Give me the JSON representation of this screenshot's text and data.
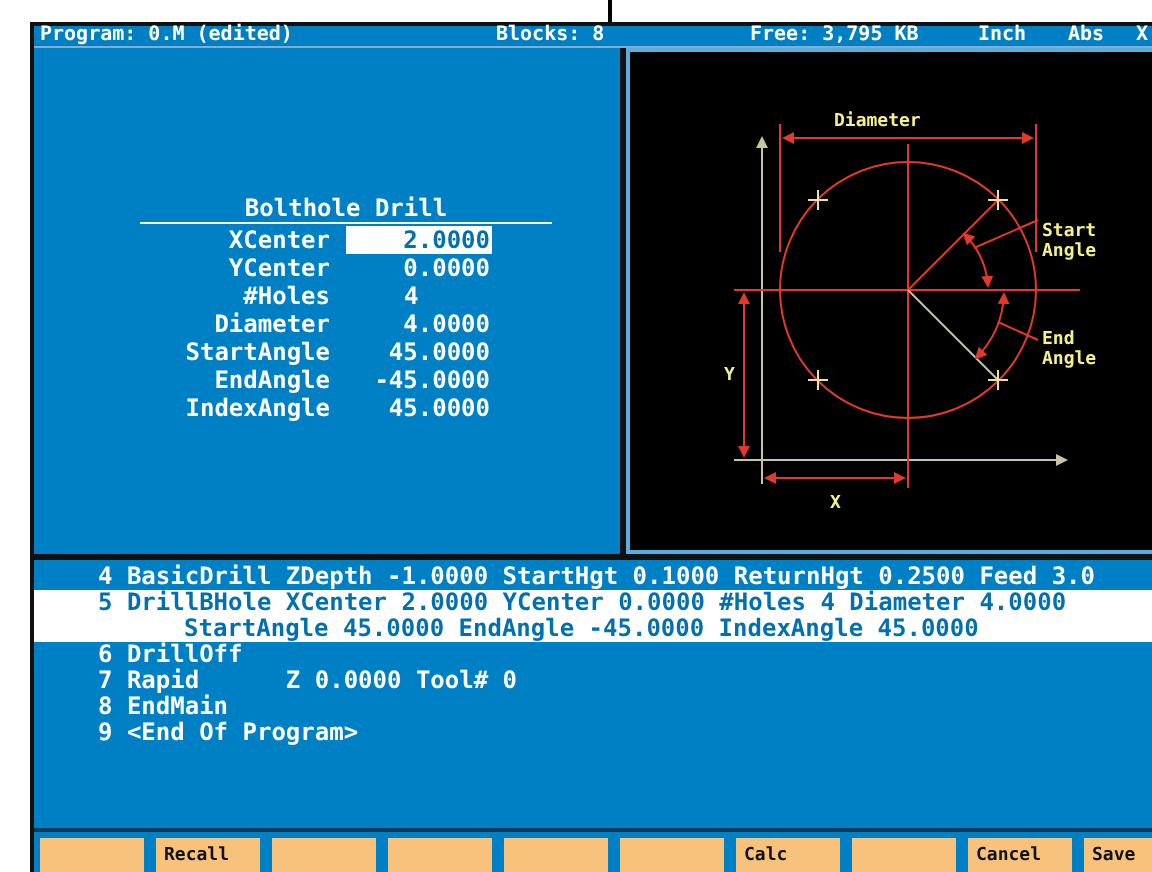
{
  "status_bar": [
    {
      "text": "Program: 0.M (edited)"
    },
    {
      "text": "Blocks: 8"
    },
    {
      "text": "Free: 3,795 KB"
    },
    {
      "text": "Inch"
    },
    {
      "text": "Abs"
    },
    {
      "text": "X"
    }
  ],
  "form": {
    "title": "Bolthole Drill",
    "fields": [
      {
        "label": "XCenter",
        "value": "2.0000",
        "kind": "decimal",
        "selected": true
      },
      {
        "label": "YCenter",
        "value": "0.0000",
        "kind": "decimal",
        "selected": false
      },
      {
        "label": "#Holes",
        "value": "4",
        "kind": "integer",
        "selected": false
      },
      {
        "label": "Diameter",
        "value": "4.0000",
        "kind": "decimal",
        "selected": false
      },
      {
        "label": "StartAngle",
        "value": "45.0000",
        "kind": "decimal",
        "selected": false
      },
      {
        "label": "EndAngle",
        "value": "-45.0000",
        "kind": "decimal",
        "selected": false
      },
      {
        "label": "IndexAngle",
        "value": "45.0000",
        "kind": "decimal",
        "selected": false
      }
    ]
  },
  "diagram": {
    "diameter_label": "Diameter",
    "start_label": [
      "Start",
      "Angle"
    ],
    "end_label": [
      "End",
      "Angle"
    ],
    "y_label": "Y",
    "x_label": "X"
  },
  "program_lines": [
    {
      "text": "4 BasicDrill ZDepth -1.0000 StartHgt 0.1000 ReturnHgt 0.2500 Feed 3.0",
      "selected": false
    },
    {
      "text": "5 DrillBHole XCenter 2.0000 YCenter 0.0000 #Holes 4 Diameter 4.0000",
      "continuation": "StartAngle 45.0000 EndAngle -45.0000 IndexAngle 45.0000",
      "selected": true
    },
    {
      "text": "6 DrillOff",
      "selected": false
    },
    {
      "text": "7 Rapid      Z 0.0000 Tool# 0",
      "selected": false
    },
    {
      "text": "8 EndMain",
      "selected": false
    },
    {
      "text": "9 <End Of Program>",
      "selected": false
    }
  ],
  "function_keys": [
    {
      "kind": "blank"
    },
    {
      "kind": "labeled",
      "label": "Recall"
    },
    {
      "kind": "blank"
    },
    {
      "kind": "blank"
    },
    {
      "kind": "blank"
    },
    {
      "kind": "blank"
    },
    {
      "kind": "labeled",
      "label": "Calc"
    },
    {
      "kind": "blank"
    },
    {
      "kind": "labeled",
      "label": "Cancel"
    },
    {
      "kind": "labeled",
      "label": "Save"
    }
  ]
}
